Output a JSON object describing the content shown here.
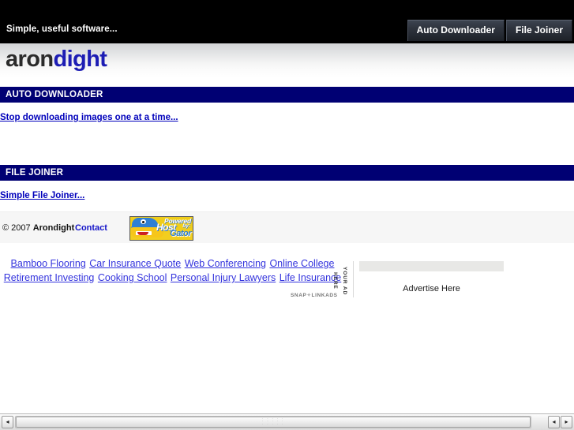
{
  "header": {
    "tagline": "Simple, useful software...",
    "tabs": [
      {
        "label": "Auto Downloader"
      },
      {
        "label": "File Joiner"
      }
    ]
  },
  "logo": {
    "part1": "aron",
    "part2": "dight"
  },
  "sections": [
    {
      "heading": "AUTO DOWNLOADER",
      "link": "Stop downloading images one at a time..."
    },
    {
      "heading": "FILE JOINER",
      "link": "Simple File Joiner..."
    }
  ],
  "footer": {
    "copyright_prefix": "© 2007 ",
    "copyright_name": "Arondight",
    "contact": "Contact",
    "hostgator": {
      "powered": "Powered",
      "by": "by:",
      "host": "Host",
      "gator": "Gator"
    }
  },
  "ads": {
    "links": [
      "Bamboo Flooring",
      "Car Insurance Quote",
      "Web Conferencing",
      "Online College",
      "Retirement Investing",
      "Cooking School",
      "Personal Injury Lawyers",
      "Life Insurance"
    ],
    "provider_brand": "SNAP",
    "provider_brand_2": "LINKADS",
    "your_ad_here": "YOUR AD HERE",
    "advertise_here": "Advertise Here"
  },
  "scrollbar": {
    "left_arrow": "◂",
    "right_arrow_1": "◂",
    "right_arrow_2": "▸"
  },
  "colors": {
    "section_header_bg": "#000073",
    "link_blue": "#0000bb",
    "logo_blue": "#1d1db4",
    "topbar_bg": "#000000"
  }
}
